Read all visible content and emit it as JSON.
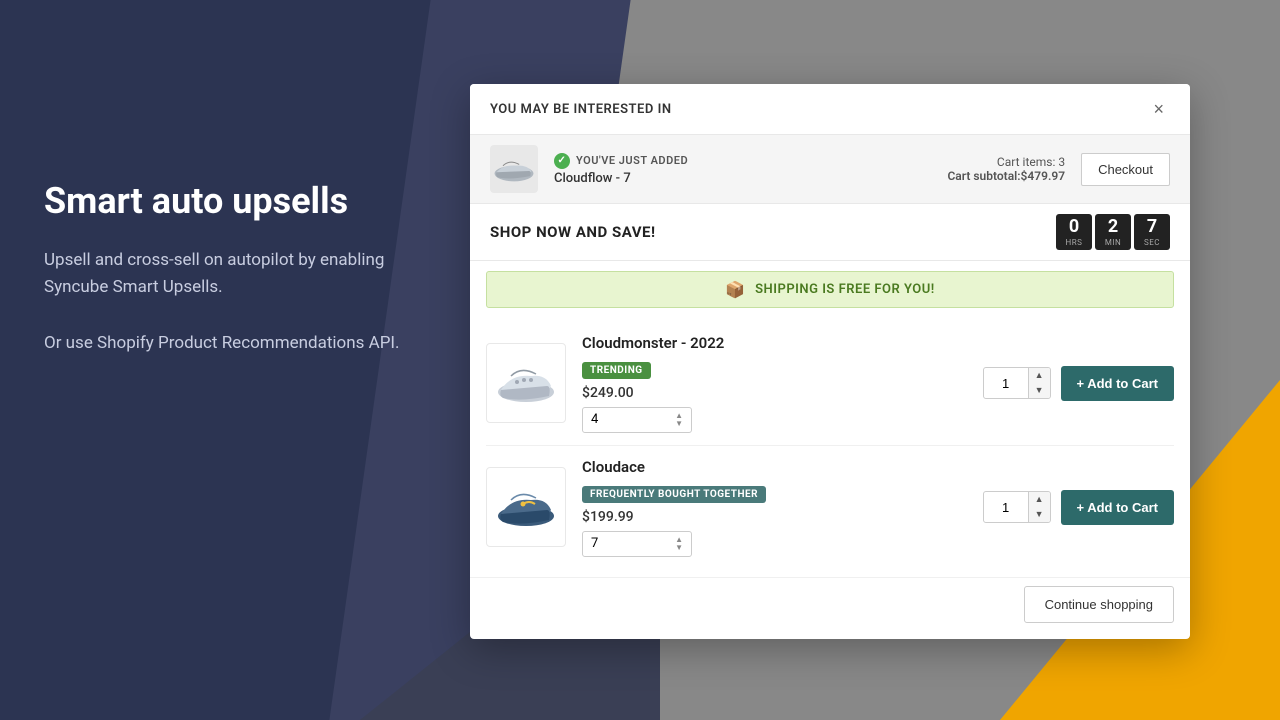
{
  "background": {
    "left_color": "#2c3452",
    "right_color": "#888888"
  },
  "left_panel": {
    "heading": "Smart auto upsells",
    "paragraph1": "Upsell and cross-sell on autopilot by enabling Syncube Smart Upsells.",
    "paragraph2": "Or use Shopify Product Recommendations API."
  },
  "modal": {
    "title": "YOU MAY BE INTERESTED IN",
    "close_label": "×",
    "cart_summary": {
      "added_label": "YOU'VE JUST ADDED",
      "product_name": "Cloudflow - 7",
      "cart_items_label": "Cart items: 3",
      "cart_subtotal_label": "Cart subtotal:",
      "cart_subtotal_value": "$479.97",
      "checkout_button": "Checkout"
    },
    "shop_now": {
      "text": "SHOP NOW AND SAVE!",
      "timer": {
        "hrs_label": "HRS",
        "hrs_value": "0",
        "min_label": "MIN",
        "min_value": "2",
        "sec_label": "SEC",
        "sec_value": "7"
      }
    },
    "shipping_bar": {
      "text": "SHIPPING IS FREE FOR YOU!"
    },
    "products": [
      {
        "name": "Cloudmonster - 2022",
        "badge": "TRENDING",
        "badge_type": "trending",
        "price": "$249.00",
        "size": "4",
        "quantity": "1",
        "add_to_cart": "+ Add to Cart"
      },
      {
        "name": "Cloudace",
        "badge": "FREQUENTLY BOUGHT TOGETHER",
        "badge_type": "fbt",
        "price": "$199.99",
        "size": "7",
        "quantity": "1",
        "add_to_cart": "+ Add to Cart"
      }
    ],
    "footer": {
      "continue_shopping": "Continue shopping"
    }
  }
}
